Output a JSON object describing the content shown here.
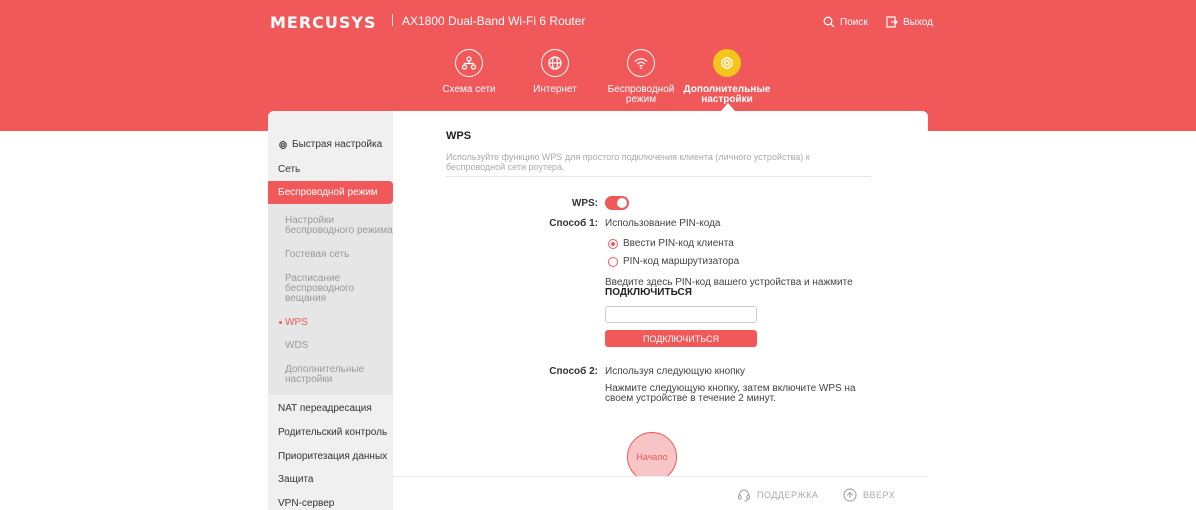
{
  "brand": "MERCUSYS",
  "model": "AX1800 Dual-Band Wi-Fi 6 Router",
  "top_actions": {
    "search": "Поиск",
    "logout": "Выход"
  },
  "nav": [
    {
      "label": "Схема сети",
      "icon": "network-map-icon"
    },
    {
      "label": "Интернет",
      "icon": "globe-icon"
    },
    {
      "label": "Беспроводной режим",
      "icon": "wifi-icon"
    },
    {
      "label": "Дополнительные настройки",
      "icon": "gear-icon",
      "active": true
    }
  ],
  "sidebar": {
    "items": [
      {
        "label": "Быстрая настройка",
        "icon": "gear-icon"
      },
      {
        "label": "Сеть"
      },
      {
        "label": "Беспроводной режим",
        "active": true
      },
      {
        "label": "NAT переадресация"
      },
      {
        "label": "Родительский контроль"
      },
      {
        "label": "Приоритезация данных"
      },
      {
        "label": "Защита"
      },
      {
        "label": "VPN-сервер"
      }
    ],
    "sub_items": [
      {
        "label": "Настройки беспроводного режима"
      },
      {
        "label": "Гостевая сеть"
      },
      {
        "label": "Расписание беспроводного вещания"
      },
      {
        "label": "WPS",
        "active": true
      },
      {
        "label": "WDS"
      },
      {
        "label": "Дополнительные настройки"
      }
    ]
  },
  "content": {
    "title": "WPS",
    "description": "Используйте функцию WPS для простого подключения клиента (личного устройства) к беспроводной сети роутера.",
    "wps_label": "WPS:",
    "wps_enabled": true,
    "method1_label": "Способ 1:",
    "method1_text": "Использование PIN-кода",
    "radio_options": [
      {
        "label": "Ввести PIN-код клиента",
        "checked": true
      },
      {
        "label": "PIN-код маршрутизатора",
        "checked": false
      }
    ],
    "pin_hint": "Введите здесь PIN-код вашего устройства и нажмите",
    "pin_hint_bold": "ПОДКЛЮЧИТЬСЯ",
    "pin_value": "",
    "connect_label": "ПОДКЛЮЧИТЬСЯ",
    "method2_label": "Способ 2:",
    "method2_text": "Используя следующую кнопку",
    "method2_desc": "Нажмите следующую кнопку, затем включите WPS на своем устройстве в течение 2 минут.",
    "start_label": "Начало"
  },
  "footer": {
    "support": "ПОДДЕРЖКА",
    "top": "ВВЕРХ"
  },
  "colors": {
    "accent": "#f0585a",
    "active_nav": "#f5c51b"
  }
}
